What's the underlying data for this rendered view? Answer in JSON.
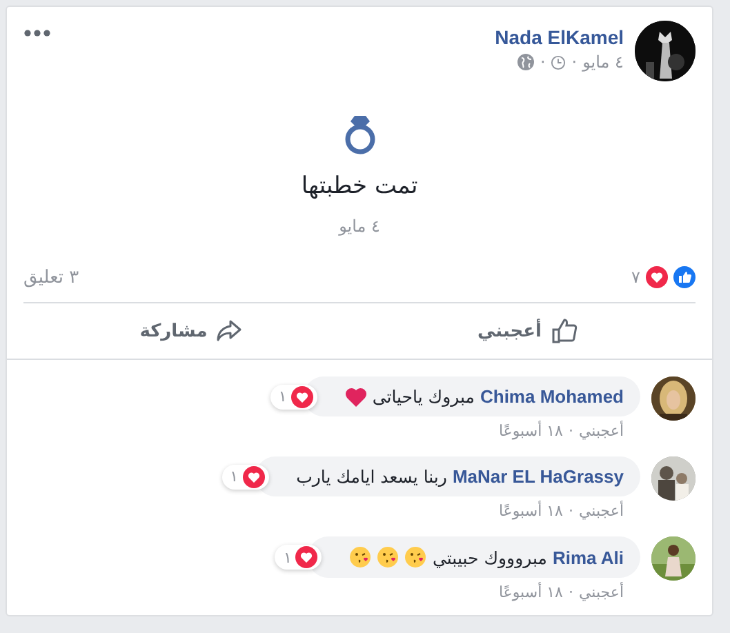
{
  "post": {
    "author": "Nada ElKamel",
    "date": "٤ مايو",
    "separator": "·",
    "event": {
      "title": "تمت خطبتها",
      "date": "٤ مايو"
    },
    "reactions": [
      {
        "kind": "like"
      },
      {
        "kind": "love"
      }
    ],
    "reaction_count": "٧",
    "comment_count": "٣ تعليق",
    "actions": [
      {
        "kind": "like",
        "label": "أعجبني"
      },
      {
        "kind": "share",
        "label": "مشاركة"
      }
    ]
  },
  "comments": [
    {
      "author": "Chima Mohamed",
      "text": "مبروك ياحياتى",
      "emojis": [
        {
          "kind": "heart"
        }
      ],
      "reaction": {
        "kind": "love",
        "count": "١"
      },
      "like_label": "أعجبني",
      "separator": "·",
      "time": "١٨ أسبوعًا"
    },
    {
      "author": "MaNar EL HaGrassy",
      "text": "ربنا يسعد ايامك يارب",
      "reaction": {
        "kind": "love",
        "count": "١"
      },
      "like_label": "أعجبني",
      "separator": "·",
      "time": "١٨ أسبوعًا"
    },
    {
      "author": "Rima Ali",
      "text": "مبروووك حبيبتي",
      "emojis": [
        {
          "kind": "kiss"
        },
        {
          "kind": "kiss"
        },
        {
          "kind": "kiss"
        }
      ],
      "reaction": {
        "kind": "love",
        "count": "١"
      },
      "like_label": "أعجبني",
      "separator": "·",
      "time": "١٨ أسبوعًا"
    }
  ]
}
